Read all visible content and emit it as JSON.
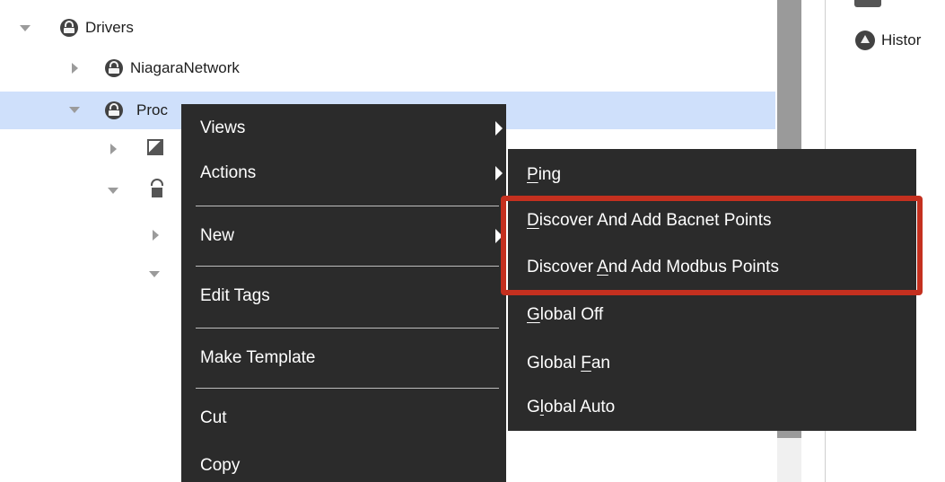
{
  "tree": {
    "drivers_label": "Drivers",
    "niagara_label": "NiagaraNetwork",
    "selected_label": "Proc"
  },
  "right_pane": {
    "history_label": "Histor"
  },
  "context_menu": {
    "views": "Views",
    "actions": "Actions",
    "new": "New",
    "edit_tags": "Edit Tags",
    "make_template": "Make Template",
    "cut": "Cut",
    "copy": "Copy"
  },
  "actions_submenu": {
    "ping": {
      "underline": "P",
      "rest": "ing"
    },
    "bacnet": {
      "underline": "D",
      "rest": "iscover And Add Bacnet Points"
    },
    "modbus": {
      "before": "Discover ",
      "underline": "A",
      "rest": "nd Add Modbus Points"
    },
    "global_off": {
      "underline": "G",
      "rest": "lobal Off"
    },
    "global_fan": {
      "before": "Global ",
      "underline": "F",
      "rest": "an"
    },
    "global_auto": {
      "before": "G",
      "underline": "l",
      "rest": "obal Auto"
    }
  },
  "colors": {
    "menu_background": "#2b2b2b",
    "selection": "#cfe0fb",
    "highlight_border": "#c4301f"
  },
  "icons": [
    "chevron-down-icon",
    "chevron-right-icon",
    "driver-icon",
    "device-icon",
    "antenna-icon",
    "history-icon",
    "submenu-arrow-icon"
  ]
}
